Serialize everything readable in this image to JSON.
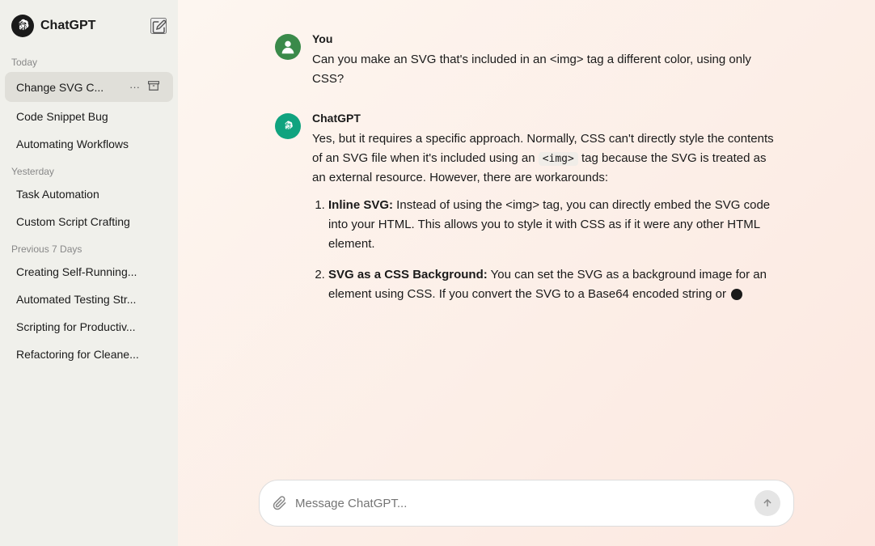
{
  "app": {
    "title": "ChatGPT",
    "new_chat_label": "New Chat"
  },
  "sidebar": {
    "sections": [
      {
        "label": "Today",
        "items": [
          {
            "id": "change-svg",
            "label": "Change SVG C...",
            "active": true,
            "has_actions": true
          },
          {
            "id": "code-snippet",
            "label": "Code Snippet Bug",
            "active": false,
            "has_actions": false
          },
          {
            "id": "automating",
            "label": "Automating Workflows",
            "active": false,
            "has_actions": false
          }
        ]
      },
      {
        "label": "Yesterday",
        "items": [
          {
            "id": "task-automation",
            "label": "Task Automation",
            "active": false,
            "has_actions": false
          },
          {
            "id": "custom-script",
            "label": "Custom Script Crafting",
            "active": false,
            "has_actions": false
          }
        ]
      },
      {
        "label": "Previous 7 Days",
        "items": [
          {
            "id": "self-running",
            "label": "Creating Self-Running...",
            "active": false,
            "has_actions": false
          },
          {
            "id": "automated-testing",
            "label": "Automated Testing Str...",
            "active": false,
            "has_actions": false
          },
          {
            "id": "scripting",
            "label": "Scripting for Productiv...",
            "active": false,
            "has_actions": false
          },
          {
            "id": "refactoring",
            "label": "Refactoring for Cleane...",
            "active": false,
            "has_actions": false
          }
        ]
      }
    ]
  },
  "chat": {
    "messages": [
      {
        "id": "user-msg",
        "sender": "You",
        "avatar_type": "user",
        "avatar_label": "U",
        "text": "Can you make an SVG that’s included in an <img> tag a different color, using only CSS?"
      },
      {
        "id": "chatgpt-msg",
        "sender": "ChatGPT",
        "avatar_type": "chatgpt",
        "intro": "Yes, but it requires a specific approach. Normally, CSS can’t directly style the contents of an SVG file when it’s included using an",
        "code_snippet": "<img>",
        "intro_after": "tag because the SVG is treated as an external resource. However, there are workarounds:",
        "list_items": [
          {
            "title": "Inline SVG:",
            "text": "Instead of using the <img> tag, you can directly embed the SVG code into your HTML. This allows you to style it with CSS as if it were any other HTML element."
          },
          {
            "title": "SVG as a CSS Background:",
            "text": "You can set the SVG as a background image for an element using CSS. If you convert the SVG to a Base64 encoded string or"
          }
        ]
      }
    ]
  },
  "input": {
    "placeholder": "Message ChatGPT...",
    "attach_label": "Attach",
    "send_label": "Send"
  }
}
